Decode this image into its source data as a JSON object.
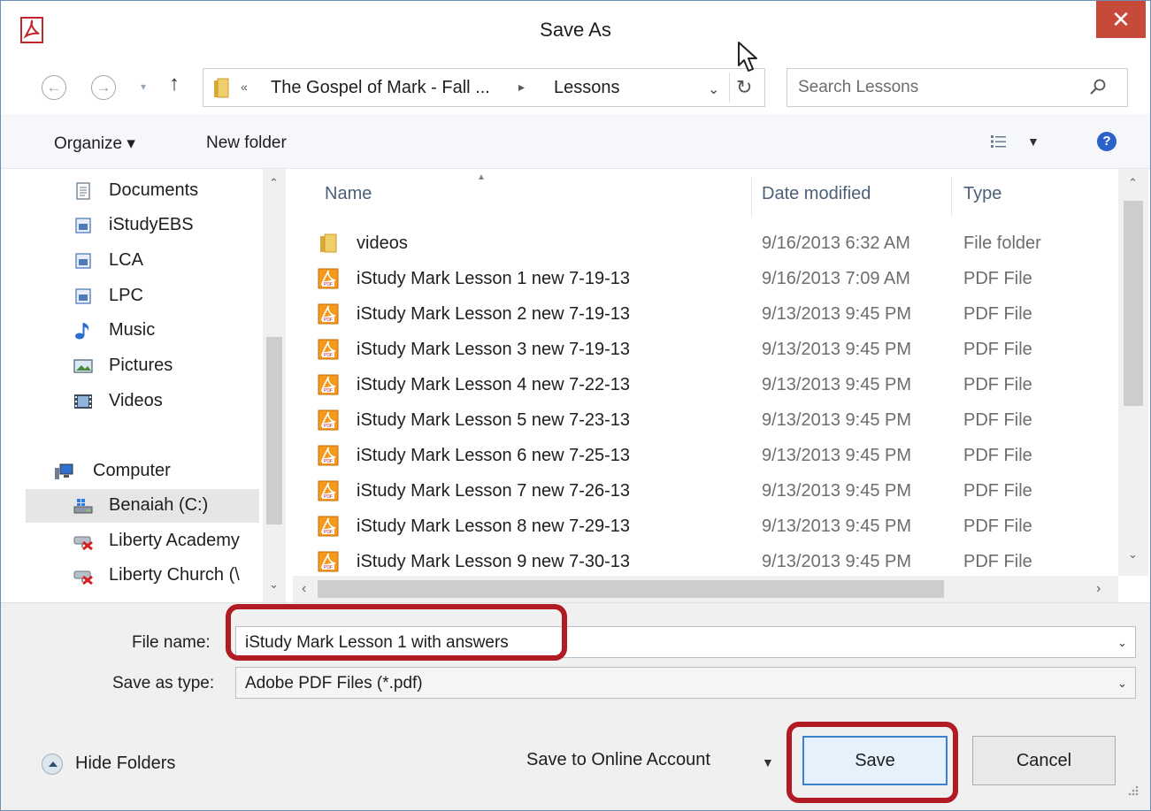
{
  "window": {
    "title": "Save As",
    "close_label": "✕"
  },
  "nav": {
    "back_label": "←",
    "forward_label": "→",
    "up_label": "↑",
    "breadcrumb": {
      "overflow": "«",
      "crumbs": [
        "The Gospel of Mark - Fall ...",
        "Lessons"
      ]
    },
    "refresh_label": "↻",
    "search_placeholder": "Search Lessons"
  },
  "toolbar": {
    "organize_label": "Organize ▾",
    "new_folder_label": "New folder"
  },
  "sidebar": {
    "items": [
      {
        "label": "Documents",
        "icon": "document-icon"
      },
      {
        "label": "iStudyEBS",
        "icon": "library-icon"
      },
      {
        "label": "LCA",
        "icon": "library-icon"
      },
      {
        "label": "LPC",
        "icon": "library-icon"
      },
      {
        "label": "Music",
        "icon": "music-icon"
      },
      {
        "label": "Pictures",
        "icon": "pictures-icon"
      },
      {
        "label": "Videos",
        "icon": "videos-icon"
      },
      {
        "label": "Computer",
        "icon": "computer-icon"
      },
      {
        "label": "Benaiah (C:)",
        "icon": "drive-icon"
      },
      {
        "label": "Liberty Academy",
        "icon": "disconnected-drive-icon"
      },
      {
        "label": "Liberty Church (\\",
        "icon": "disconnected-drive-icon"
      }
    ],
    "selected": "Benaiah (C:)"
  },
  "file_list": {
    "columns": [
      "Name",
      "Date modified",
      "Type"
    ],
    "rows": [
      {
        "name": "videos",
        "date": "9/16/2013 6:32 AM",
        "type": "File folder",
        "icon": "folder-icon"
      },
      {
        "name": "iStudy Mark Lesson 1 new 7-19-13",
        "date": "9/16/2013 7:09 AM",
        "type": "PDF File",
        "icon": "pdf-icon"
      },
      {
        "name": "iStudy Mark Lesson 2 new 7-19-13",
        "date": "9/13/2013 9:45 PM",
        "type": "PDF File",
        "icon": "pdf-icon"
      },
      {
        "name": "iStudy Mark Lesson 3 new 7-19-13",
        "date": "9/13/2013 9:45 PM",
        "type": "PDF File",
        "icon": "pdf-icon"
      },
      {
        "name": "iStudy Mark Lesson 4 new 7-22-13",
        "date": "9/13/2013 9:45 PM",
        "type": "PDF File",
        "icon": "pdf-icon"
      },
      {
        "name": "iStudy Mark Lesson 5 new 7-23-13",
        "date": "9/13/2013 9:45 PM",
        "type": "PDF File",
        "icon": "pdf-icon"
      },
      {
        "name": "iStudy Mark Lesson 6 new 7-25-13",
        "date": "9/13/2013 9:45 PM",
        "type": "PDF File",
        "icon": "pdf-icon"
      },
      {
        "name": "iStudy Mark Lesson 7 new 7-26-13",
        "date": "9/13/2013 9:45 PM",
        "type": "PDF File",
        "icon": "pdf-icon"
      },
      {
        "name": "iStudy Mark Lesson 8 new 7-29-13",
        "date": "9/13/2013 9:45 PM",
        "type": "PDF File",
        "icon": "pdf-icon"
      },
      {
        "name": "iStudy Mark Lesson 9 new 7-30-13",
        "date": "9/13/2013 9:45 PM",
        "type": "PDF File",
        "icon": "pdf-icon"
      }
    ]
  },
  "form": {
    "file_name_label": "File name:",
    "file_name_value": "iStudy Mark Lesson 1 with answers",
    "save_type_label": "Save as type:",
    "save_type_value": "Adobe PDF Files (*.pdf)"
  },
  "footer": {
    "hide_folders_label": "Hide Folders",
    "online_account_label": "Save to Online Account",
    "save_label": "Save",
    "cancel_label": "Cancel"
  },
  "colors": {
    "highlight": "#b11b24",
    "close_button": "#c7493a",
    "pdf_orange": "#f39a1c",
    "folder_yellow": "#e9c45a"
  }
}
